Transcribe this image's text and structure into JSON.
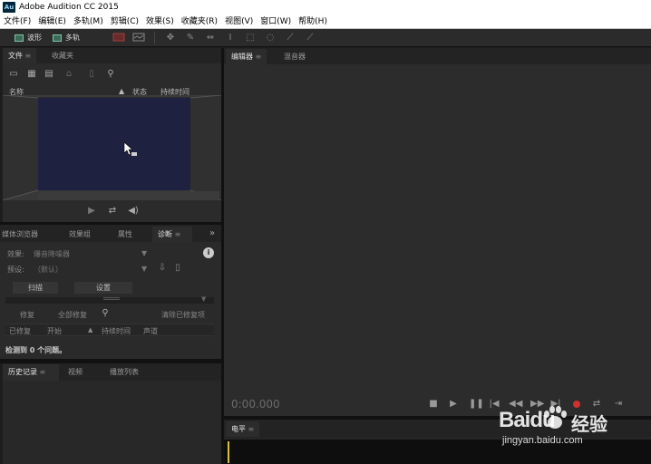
{
  "title_bar": {
    "logo": "Au",
    "title": "Adobe Audition CC 2015"
  },
  "menu": [
    "文件(F)",
    "编辑(E)",
    "多轨(M)",
    "剪辑(C)",
    "效果(S)",
    "收藏夹(R)",
    "视图(V)",
    "窗口(W)",
    "帮助(H)"
  ],
  "toolbar": {
    "waveform_label": "波形",
    "multitrack_label": "多轨"
  },
  "files_panel": {
    "tabs": [
      "文件",
      "收藏夹"
    ],
    "columns": {
      "name": "名称",
      "status": "状态",
      "duration": "持续时间"
    }
  },
  "lower_left_panel": {
    "tabs": [
      "媒体浏览器",
      "效果组",
      "属性",
      "诊断"
    ],
    "effect_label": "效果:",
    "effect_value": "爆音降噪器",
    "preset_label": "预设:",
    "preset_value": "（默认）",
    "scan_button": "扫描",
    "settings_button": "设置",
    "repair_button": "修复",
    "repair_all_button": "全部修复",
    "clear_repaired_button": "清除已修复项",
    "columns": [
      "已修复",
      "开始",
      "持续时间",
      "声道"
    ],
    "status_text": "检测到 0 个问题。"
  },
  "history_panel": {
    "tabs": [
      "历史记录",
      "视频",
      "播放列表"
    ]
  },
  "editor_panel": {
    "tabs": [
      "编辑器",
      "混音器"
    ],
    "time": "0:00.000"
  },
  "level_panel": {
    "title": "电平"
  },
  "watermark": {
    "brand": "Baidu",
    "cn": "经验",
    "url": "jingyan.baidu.com"
  },
  "colors": {
    "accent_record": "#d0302e",
    "video_area": "#1f2140",
    "timecode": "#6b6b6b"
  }
}
